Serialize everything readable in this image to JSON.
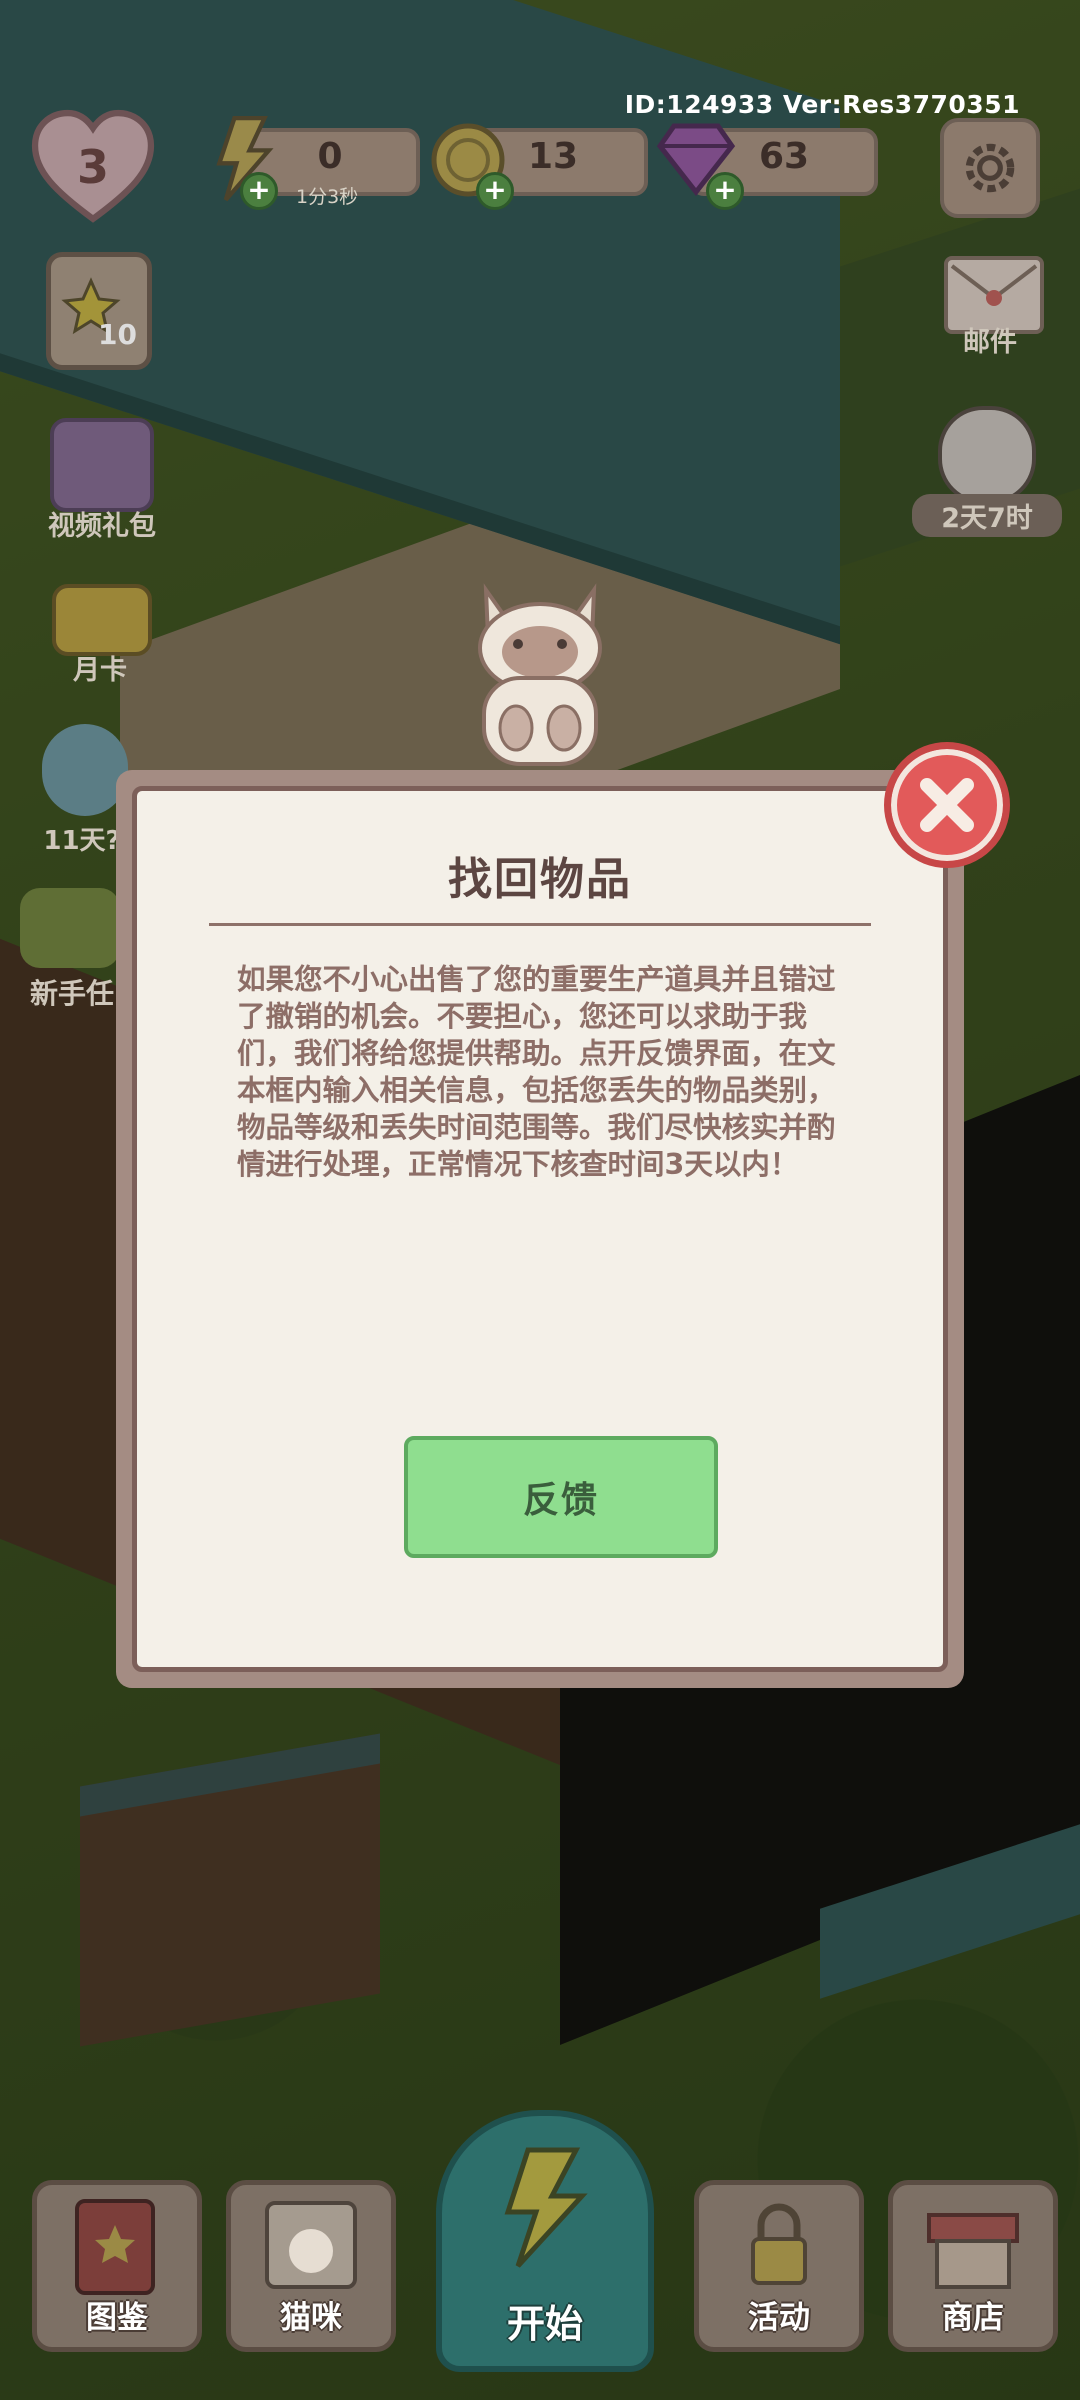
{
  "hud": {
    "id_version": "ID:124933 Ver:Res3770351",
    "hearts": "3",
    "energy": {
      "value": "0",
      "timer": "1分3秒"
    },
    "coins": {
      "value": "13"
    },
    "gems": {
      "value": "63"
    },
    "star_box_count": "10"
  },
  "left_side": {
    "video_gift": "视频礼包",
    "month_card": "月卡",
    "event_days": "11天?",
    "newbie": "新手任"
  },
  "right_side": {
    "mail": "邮件",
    "panda_timer": "2天7时"
  },
  "dialog": {
    "title": "找回物品",
    "body": "如果您不小心出售了您的重要生产道具并且错过了撤销的机会。不要担心，您还可以求助于我们，我们将给您提供帮助。点开反馈界面，在文本框内输入相关信息，包括您丢失的物品类别，物品等级和丢失时间范围等。我们尽快核实并酌情进行处理，正常情况下核查时间3天以内！",
    "button": "反馈"
  },
  "bottom_nav": {
    "handbook": "图鉴",
    "cats": "猫咪",
    "start": "开始",
    "events": "活动",
    "shop": "商店"
  }
}
